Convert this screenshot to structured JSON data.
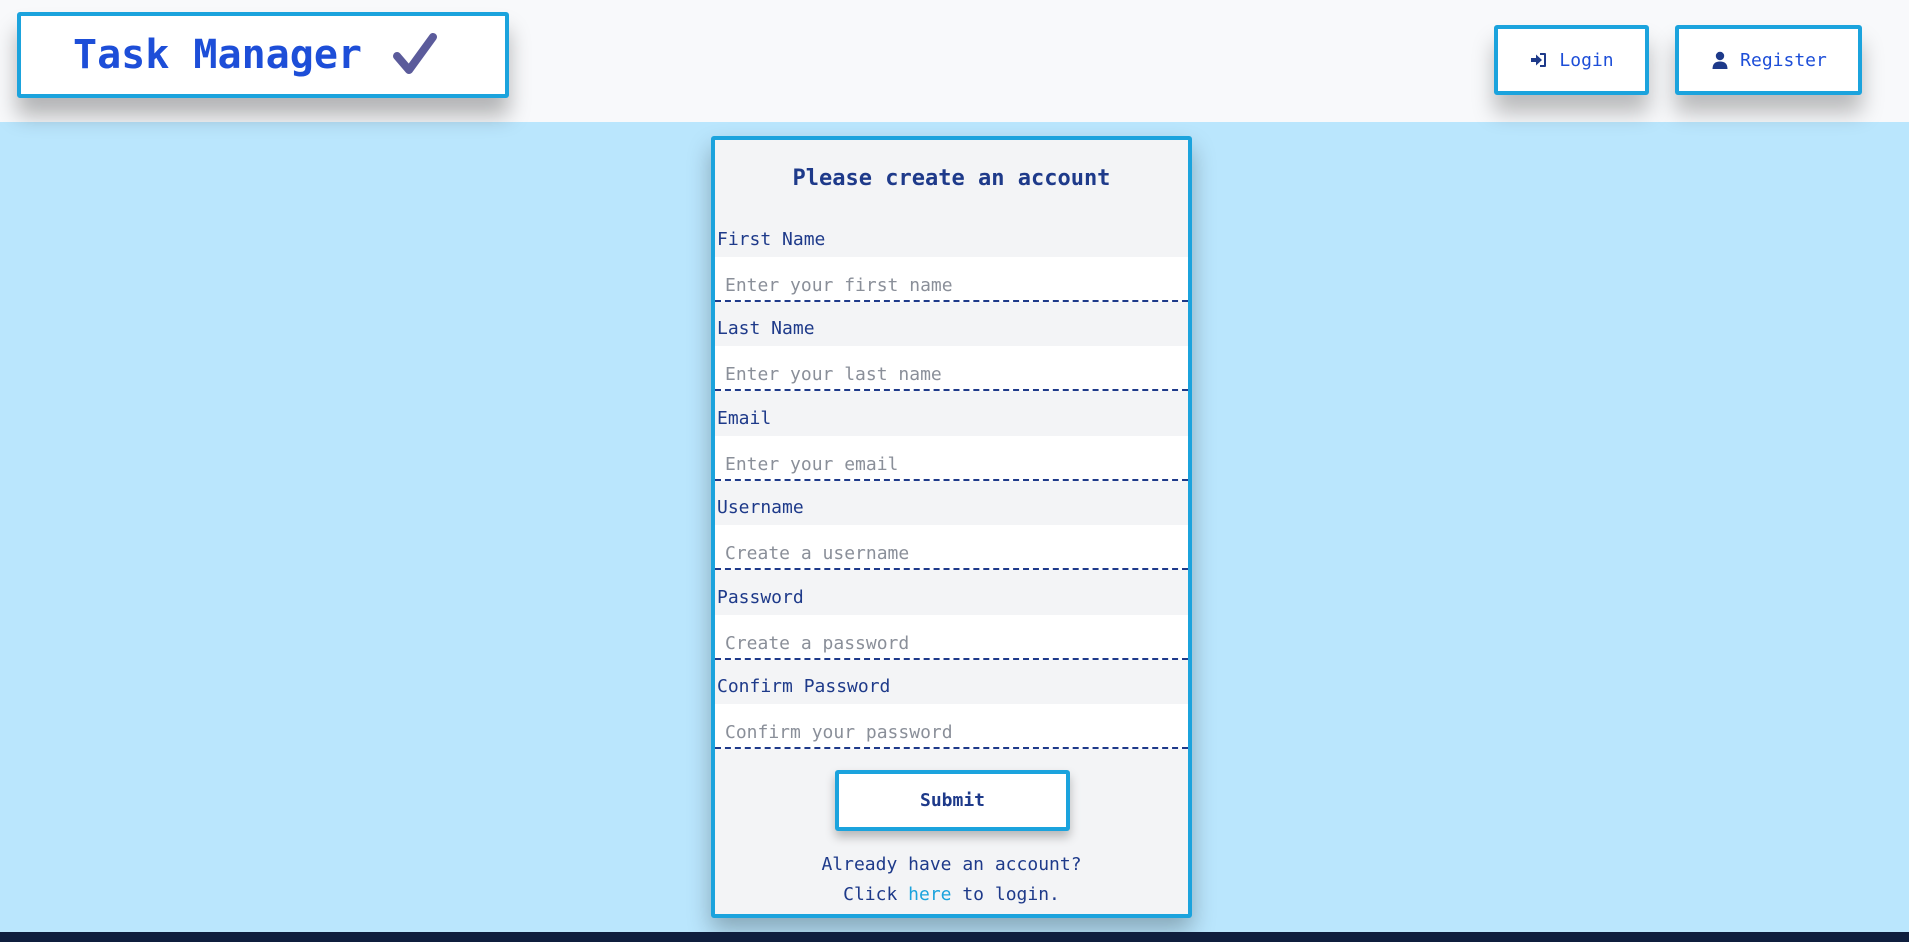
{
  "header": {
    "brand_title": "Task Manager",
    "brand_icon": "checkmark-icon",
    "login_label": "Login",
    "login_icon": "sign-in-icon",
    "register_label": "Register",
    "register_icon": "user-icon"
  },
  "form": {
    "title": "Please create an account",
    "fields": [
      {
        "label": "First Name",
        "placeholder": "Enter your first name",
        "value": ""
      },
      {
        "label": "Last Name",
        "placeholder": "Enter your last name",
        "value": ""
      },
      {
        "label": "Email",
        "placeholder": "Enter your email",
        "value": ""
      },
      {
        "label": "Username",
        "placeholder": "Create a username",
        "value": ""
      },
      {
        "label": "Password",
        "placeholder": "Create a password",
        "value": ""
      },
      {
        "label": "Confirm Password",
        "placeholder": "Confirm your password",
        "value": ""
      }
    ],
    "submit_label": "Submit",
    "footer_line1": "Already have an account?",
    "footer_click": "Click",
    "footer_link": "here",
    "footer_after": "to login."
  },
  "colors": {
    "accent": "#1ba3dd",
    "text": "#1e3a8a",
    "page_bg": "#bae6fd",
    "check": "#5b5b9b"
  }
}
